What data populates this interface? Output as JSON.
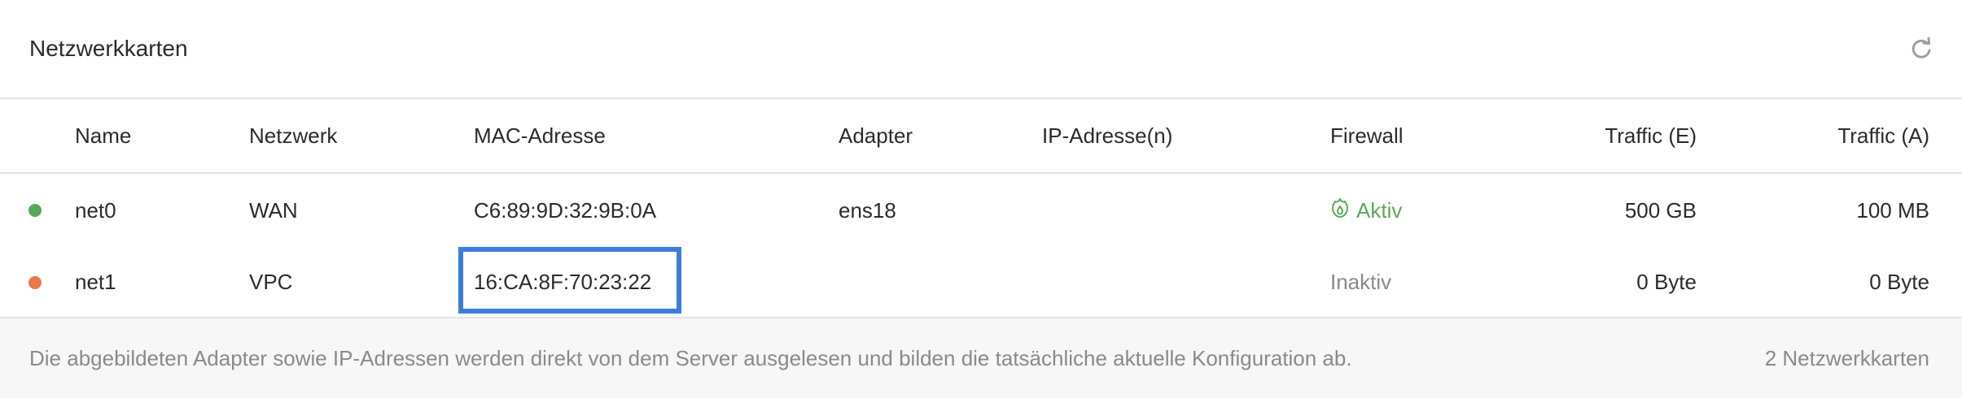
{
  "panel": {
    "title": "Netzwerkkarten",
    "refresh_icon": "refresh-icon"
  },
  "table": {
    "columns": {
      "name": "Name",
      "network": "Netzwerk",
      "mac": "MAC-Adresse",
      "adapter": "Adapter",
      "ip": "IP-Adresse(n)",
      "firewall": "Firewall",
      "traffic_in": "Traffic (E)",
      "traffic_out": "Traffic (A)"
    },
    "rows": [
      {
        "status_color": "#5aa85a",
        "name": "net0",
        "network": "WAN",
        "mac": "C6:89:9D:32:9B:0A",
        "adapter": "ens18",
        "ip": "",
        "firewall": "Aktiv",
        "firewall_icon": "shield-flame-icon",
        "traffic_in": "500 GB",
        "traffic_out": "100 MB"
      },
      {
        "status_color": "#e8794a",
        "name": "net1",
        "network": "VPC",
        "mac": "16:CA:8F:70:23:22",
        "adapter": "",
        "ip": "",
        "firewall": "Inaktiv",
        "traffic_in": "0 Byte",
        "traffic_out": "0 Byte"
      }
    ]
  },
  "footer": {
    "note": "Die abgebildeten Adapter sowie IP-Adressen werden direkt von dem Server ausgelesen und bilden die tatsächliche aktuelle Konfiguration ab.",
    "count": "2 Netzwerkkarten"
  },
  "colors": {
    "accent_green": "#5aa85a",
    "accent_orange": "#e8794a",
    "highlight_blue": "#3b7ddd"
  }
}
